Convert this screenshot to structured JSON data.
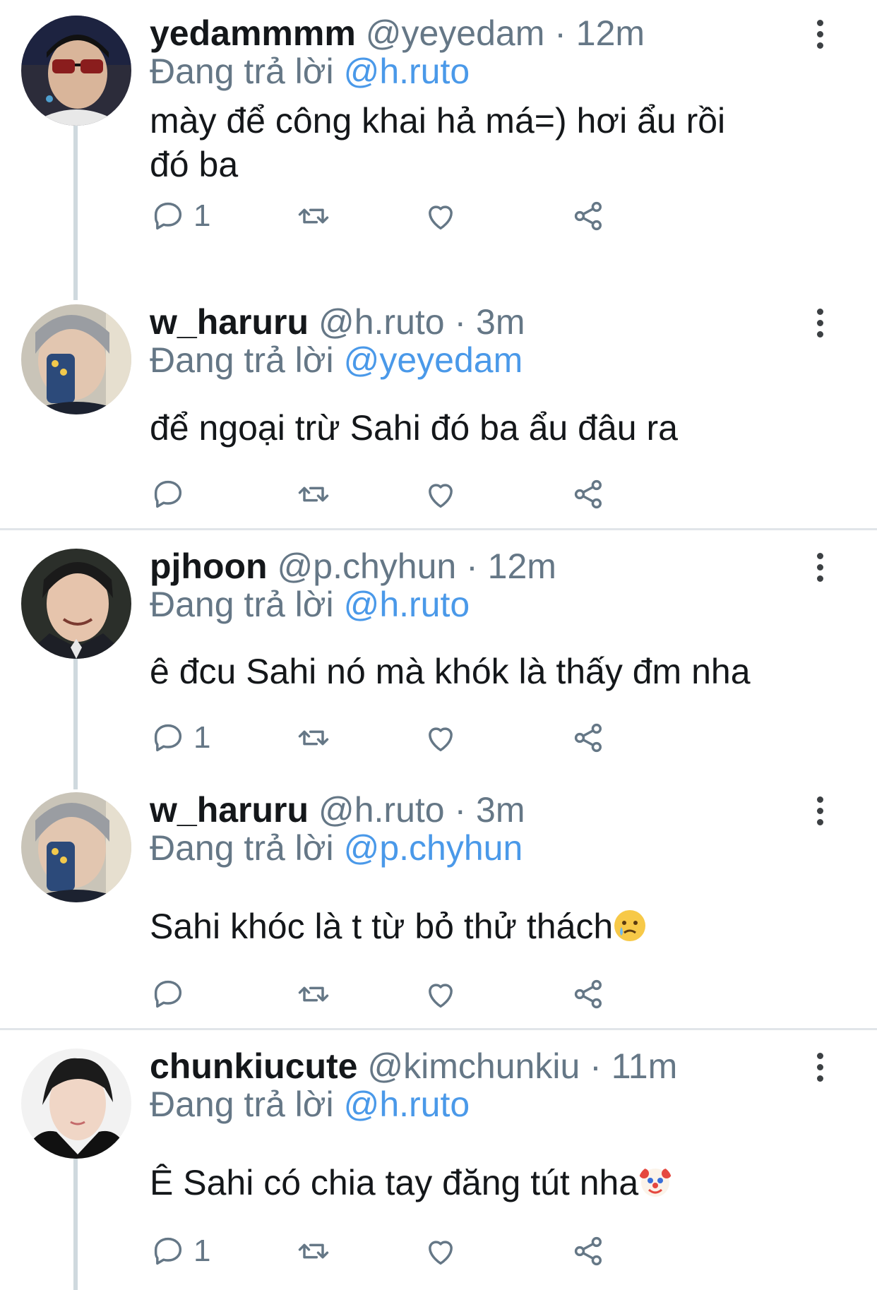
{
  "tweets": [
    {
      "name": "yedammmm",
      "handle": "@yeyedam",
      "time": "· 12m",
      "reply_prefix": "Đang trả lời",
      "reply_to": "@h.ruto",
      "text": "mày để công khai hả má=) hơi ẩu rồi đó ba",
      "reply_count": "1"
    },
    {
      "name": "w_haruru",
      "handle": "@h.ruto",
      "time": "· 3m",
      "reply_prefix": "Đang trả lời",
      "reply_to": "@yeyedam",
      "text": "để ngoại trừ Sahi đó ba ẩu đâu ra",
      "reply_count": ""
    },
    {
      "name": "pjhoon",
      "handle": "@p.chyhun",
      "time": "· 12m",
      "reply_prefix": "Đang trả lời",
      "reply_to": "@h.ruto",
      "text": "ê đcu Sahi nó mà khók là thấy đm nha",
      "reply_count": "1"
    },
    {
      "name": "w_haruru",
      "handle": "@h.ruto",
      "time": "· 3m",
      "reply_prefix": "Đang trả lời",
      "reply_to": "@p.chyhun",
      "text": "Sahi khóc là t từ bỏ thử thách",
      "emoji": "crying-face",
      "reply_count": ""
    },
    {
      "name": "chunkiucute",
      "handle": "@kimchunkiu",
      "time": "· 11m",
      "reply_prefix": "Đang trả lời",
      "reply_to": "@h.ruto",
      "text": "Ê Sahi có chia tay đăng tút nha",
      "emoji": "clown-face",
      "reply_count": "1"
    }
  ],
  "colors": {
    "link": "#4a99e9",
    "meta": "#657786",
    "thread_line": "#cfd9de",
    "divider": "#e1e5e9"
  },
  "icons": [
    "reply-icon",
    "retweet-icon",
    "like-icon",
    "share-icon",
    "more-icon"
  ]
}
